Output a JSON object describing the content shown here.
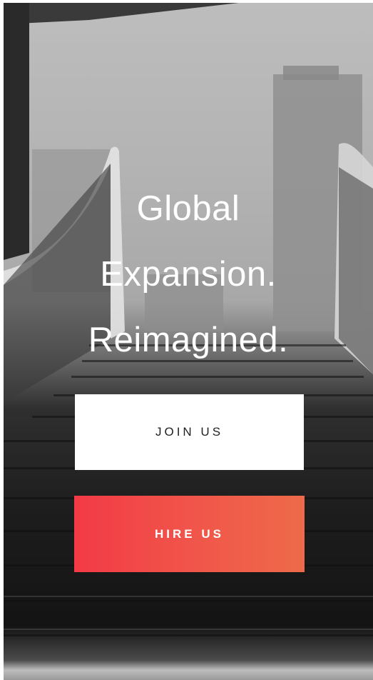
{
  "hero": {
    "headline": [
      "Global",
      "Expansion.",
      "Reimagined."
    ]
  },
  "actions": {
    "join_label": "JOIN US",
    "hire_label": "HIRE US"
  },
  "colors": {
    "primary_button_bg": "#ffffff",
    "accent_gradient_start": "#f33a46",
    "accent_gradient_end": "#ee6a4a",
    "headline_text": "#ffffff"
  }
}
